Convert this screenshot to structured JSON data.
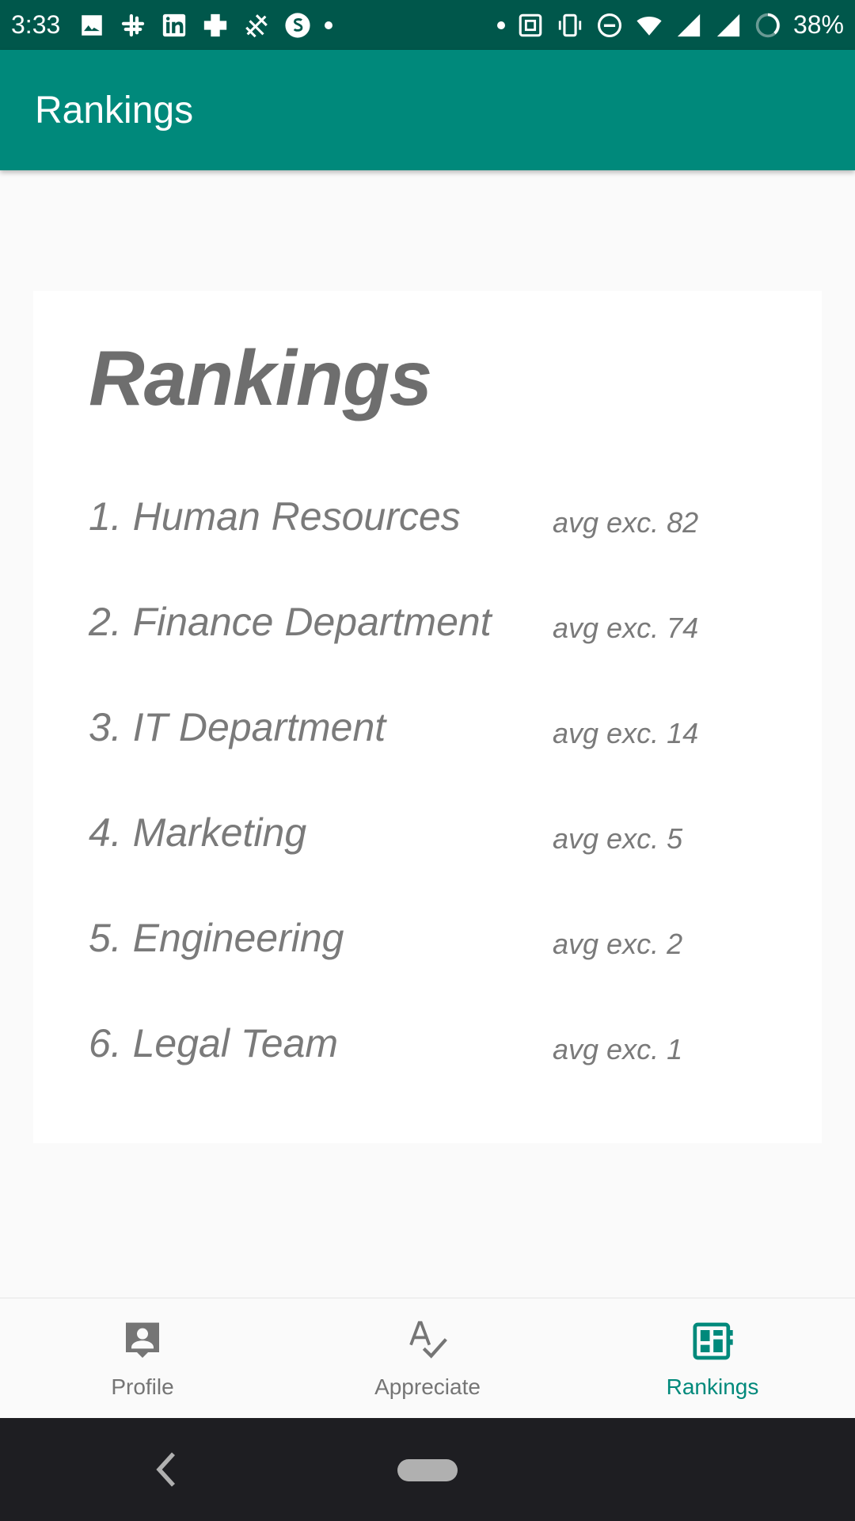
{
  "status_bar": {
    "time": "3:33",
    "battery": "38%",
    "left_icons": [
      "image-icon",
      "slack-icon",
      "linkedin-icon",
      "plus-icon",
      "cactus-icon",
      "s-logo-icon",
      "dot"
    ],
    "right_icons": [
      "dot",
      "nfc-icon",
      "vibrate-icon",
      "dnd-icon",
      "wifi-icon",
      "signal-x-icon",
      "signal-icon",
      "battery-ring-icon"
    ]
  },
  "app_bar": {
    "title": "Rankings"
  },
  "card": {
    "title": "Rankings",
    "rows": [
      {
        "name": "1. Human Resources",
        "score": "avg exc. 82"
      },
      {
        "name": "2. Finance Department",
        "score": "avg exc. 74"
      },
      {
        "name": "3. IT Department",
        "score": "avg exc. 14"
      },
      {
        "name": "4. Marketing",
        "score": "avg exc. 5"
      },
      {
        "name": "5. Engineering",
        "score": "avg exc. 2"
      },
      {
        "name": "6. Legal Team",
        "score": "avg exc. 1"
      }
    ]
  },
  "bottom_nav": {
    "items": [
      {
        "label": "Profile",
        "icon": "profile-icon",
        "active": false
      },
      {
        "label": "Appreciate",
        "icon": "spellcheck-icon",
        "active": false
      },
      {
        "label": "Rankings",
        "icon": "dashboard-icon",
        "active": true
      }
    ],
    "active_color": "#00897b",
    "inactive_color": "#757575"
  },
  "colors": {
    "status_bar": "#00574b",
    "app_bar": "#00897b",
    "card_text": "#7a7a7a"
  }
}
